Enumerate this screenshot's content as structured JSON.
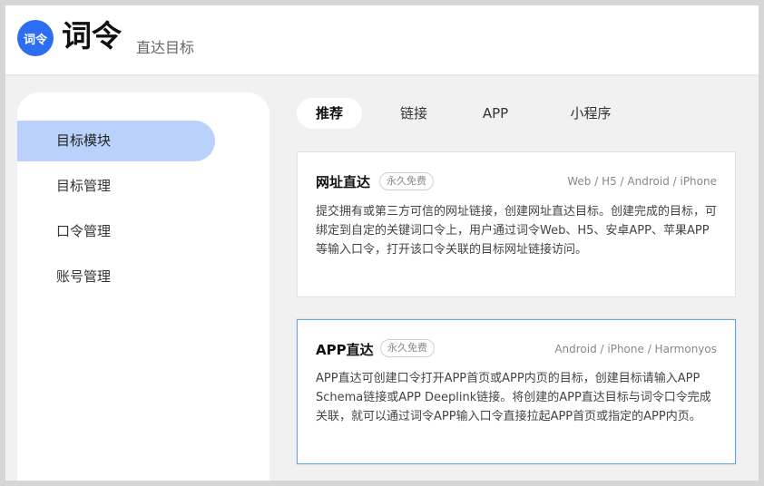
{
  "header": {
    "logo_text": "词令",
    "brand": "词令",
    "tagline": "直达目标"
  },
  "sidebar": {
    "items": [
      {
        "label": "目标模块",
        "active": true
      },
      {
        "label": "目标管理",
        "active": false
      },
      {
        "label": "口令管理",
        "active": false
      },
      {
        "label": "账号管理",
        "active": false
      }
    ]
  },
  "tabs": [
    {
      "label": "推荐",
      "active": true
    },
    {
      "label": "链接",
      "active": false
    },
    {
      "label": "APP",
      "active": false
    },
    {
      "label": "小程序",
      "active": false
    }
  ],
  "cards": [
    {
      "title": "网址直达",
      "badge": "永久免费",
      "platforms": "Web / H5 / Android / iPhone",
      "description": "提交拥有或第三方可信的网址链接，创建网址直达目标。创建完成的目标，可绑定到自定的关键词口令上，用户通过词令Web、H5、安卓APP、苹果APP等输入口令，打开该口令关联的目标网址链接访问。"
    },
    {
      "title": "APP直达",
      "badge": "永久免费",
      "platforms": "Android / iPhone / Harmonyos",
      "description": "APP直达可创建口令打开APP首页或APP内页的目标，创建目标请输入APP Schema链接或APP Deeplink链接。将创建的APP直达目标与词令口令完成关联，就可以通过词令APP输入口令直接拉起APP首页或指定的APP内页。"
    }
  ],
  "colors": {
    "accent": "#2d6df2",
    "sidebar_active": "#b9d1fb",
    "selected_border": "#6aa5e6"
  }
}
